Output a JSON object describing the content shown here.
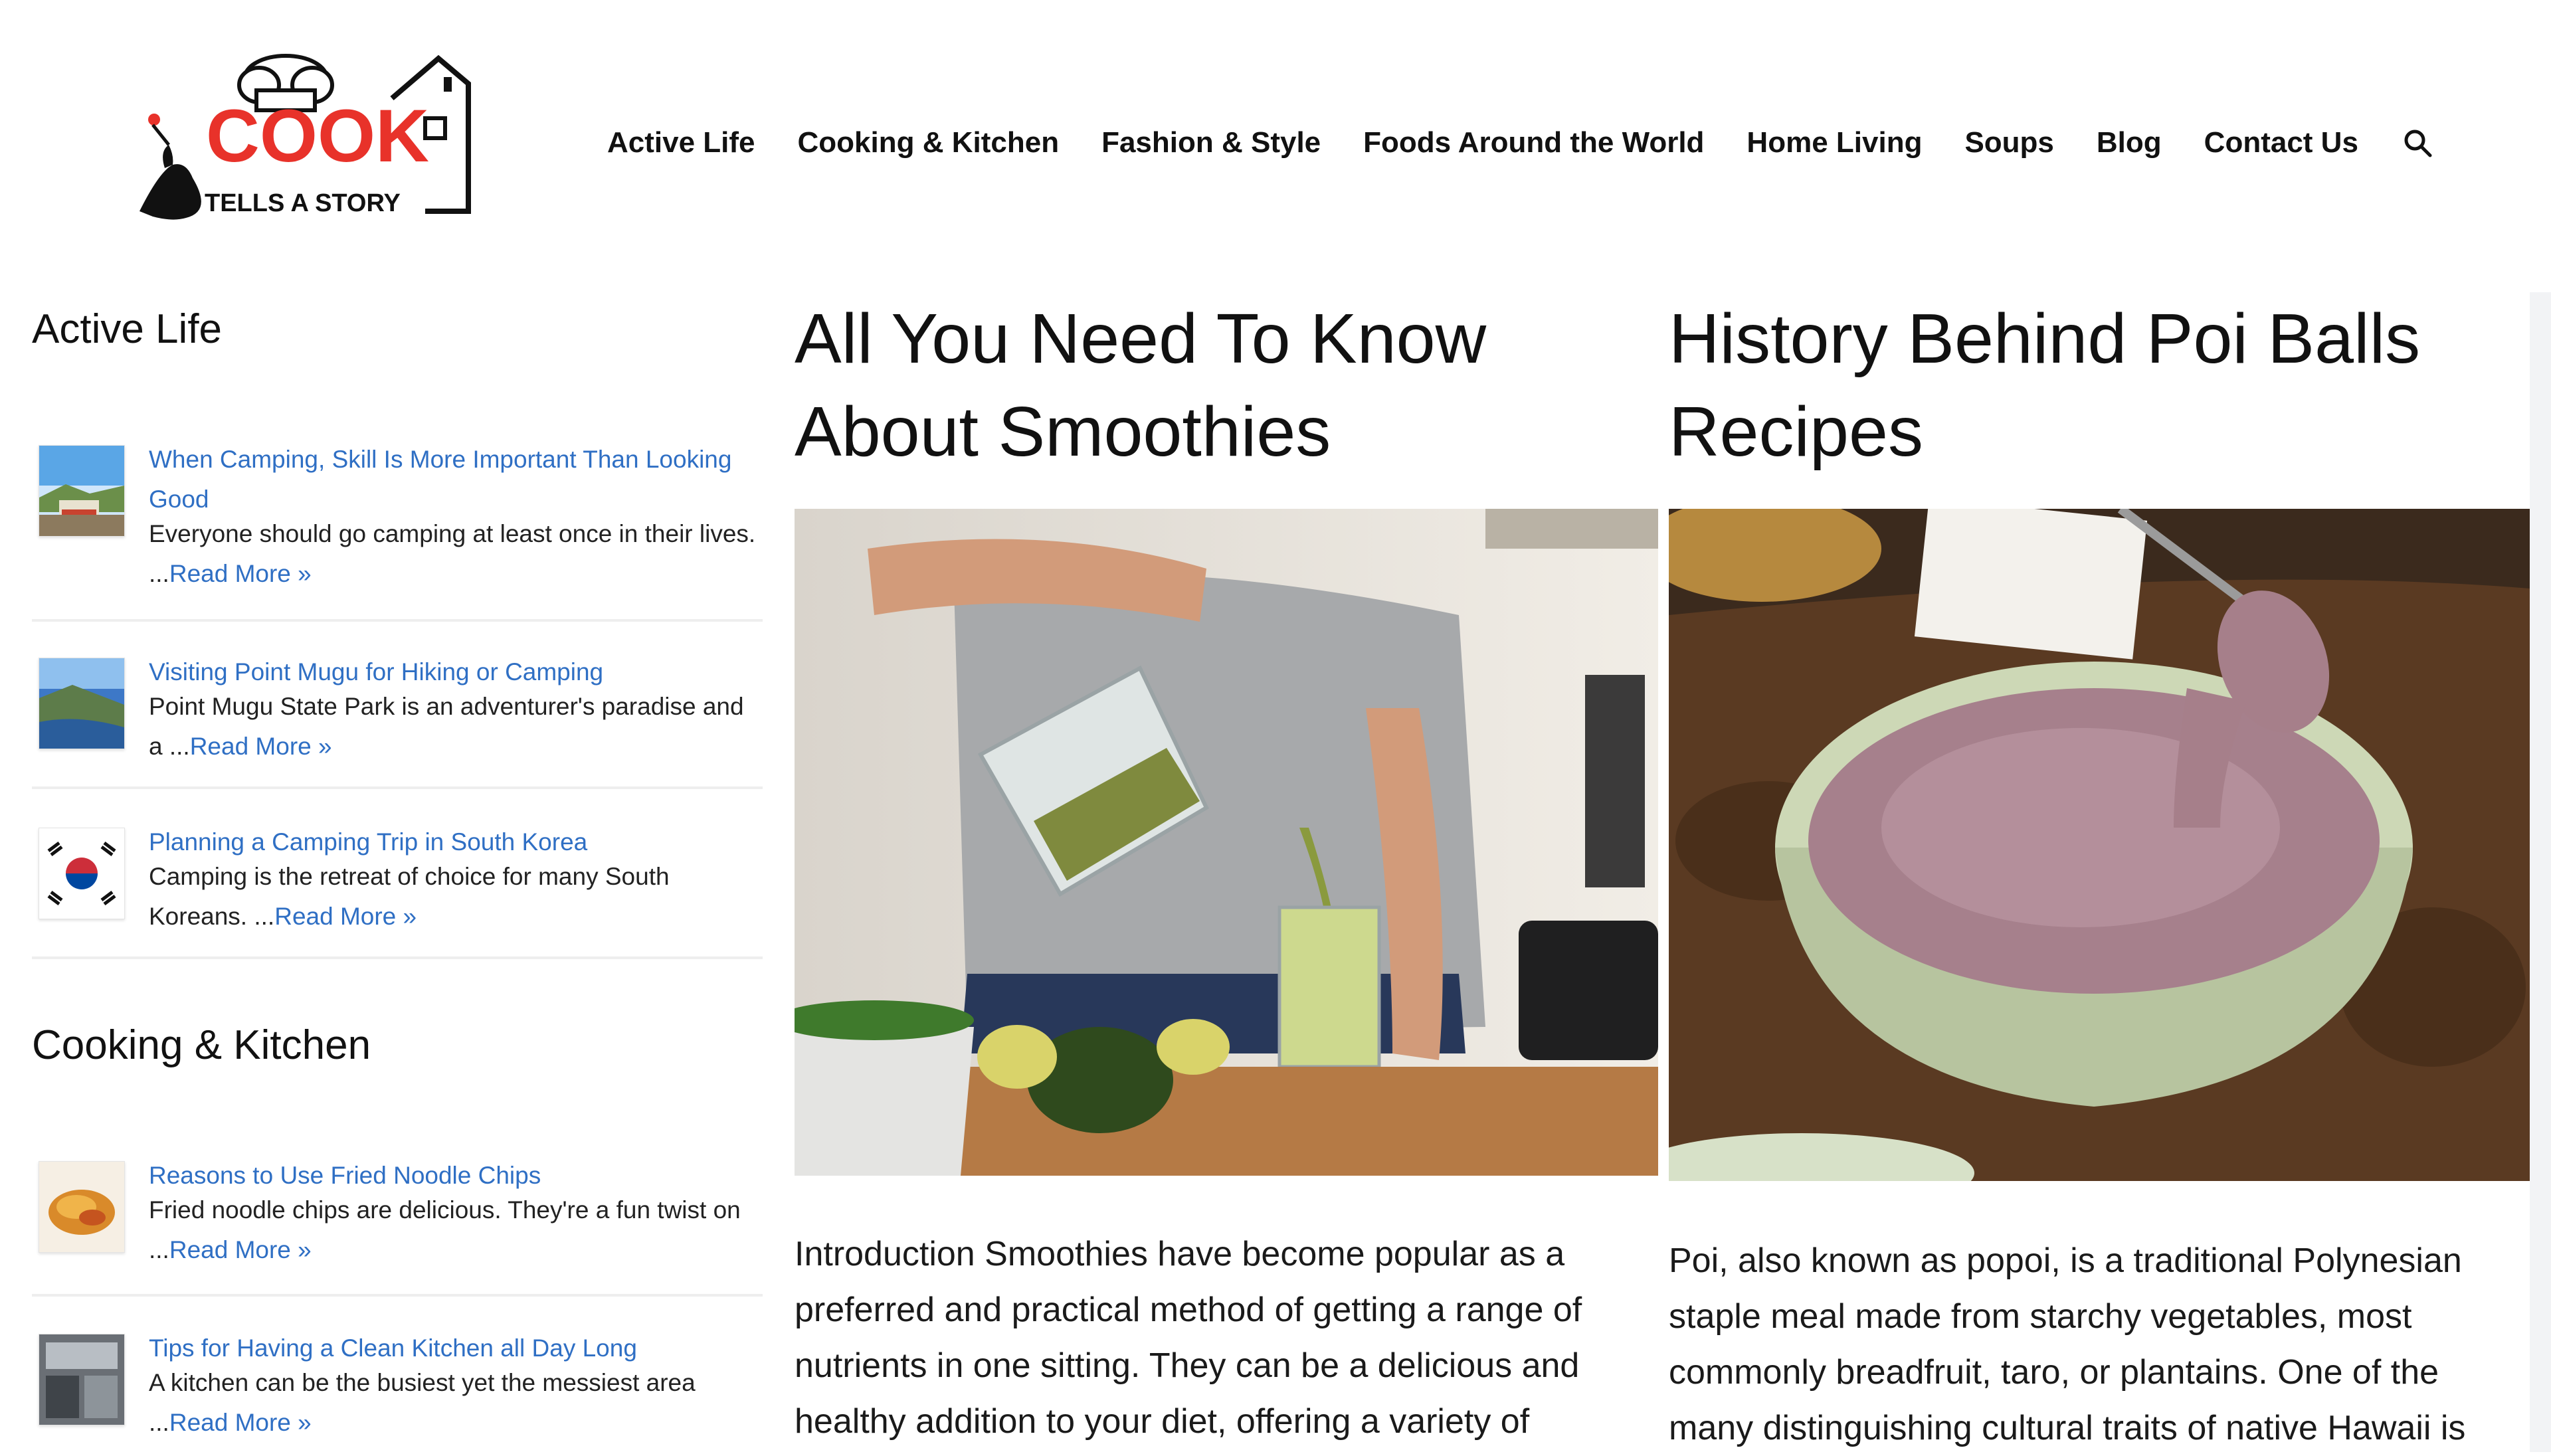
{
  "logo": {
    "word": "COOK",
    "tagline": "TELLS A STORY"
  },
  "nav": {
    "items": [
      "Active Life",
      "Cooking & Kitchen",
      "Fashion & Style",
      "Foods Around the World",
      "Home Living",
      "Soups",
      "Blog",
      "Contact Us"
    ],
    "search_icon": "search-icon"
  },
  "sidebar": {
    "sections": [
      {
        "title": "Active Life",
        "posts": [
          {
            "title": "When Camping, Skill Is More Important Than Looking Good",
            "excerpt": "Everyone should go camping at least once in their lives. ...",
            "read_more": "Read More »"
          },
          {
            "title": "Visiting Point Mugu for Hiking or Camping",
            "excerpt": "Point Mugu State Park is an adventurer's paradise and a ...",
            "read_more": "Read More »"
          },
          {
            "title": "Planning a Camping Trip in South Korea",
            "excerpt": "Camping is the retreat of choice for many South Koreans. ...",
            "read_more": "Read More »"
          }
        ]
      },
      {
        "title": "Cooking & Kitchen",
        "posts": [
          {
            "title": "Reasons to Use Fried Noodle Chips",
            "excerpt": "Fried noodle chips are delicious. They're a fun twist on ...",
            "read_more": "Read More »"
          },
          {
            "title": "Tips for Having a Clean Kitchen all Day Long",
            "excerpt": "A kitchen can be the busiest yet the messiest area ...",
            "read_more": "Read More »"
          }
        ]
      }
    ]
  },
  "articles": [
    {
      "title": "All You Need To Know About Smoothies",
      "excerpt": "Introduction Smoothies have become popular as a preferred and practical method of getting a range of nutrients in one sitting. They can be a delicious and healthy addition to your diet, offering a variety of"
    },
    {
      "title": "History Behind Poi Balls Recipes",
      "excerpt": "Poi, also known as popoi, is a traditional Polynesian staple meal made from starchy vegetables, most commonly breadfruit, taro, or plantains. One of the many distinguishing cultural traits of native Hawaii is"
    }
  ],
  "colors": {
    "link": "#2f6fc4",
    "brand_red": "#e8322a",
    "text": "#111111"
  }
}
